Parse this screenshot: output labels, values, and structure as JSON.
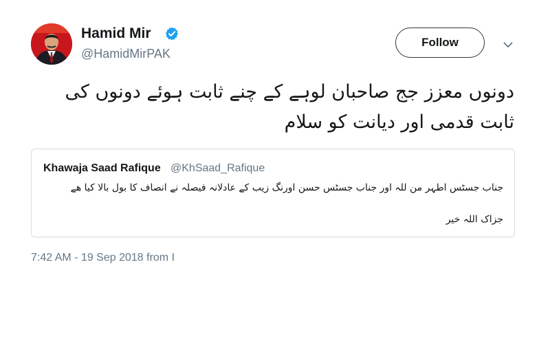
{
  "author": {
    "name": "Hamid Mir",
    "handle": "@HamidMirPAK",
    "verified": true,
    "avatar_icon": "profile-photo"
  },
  "actions": {
    "follow_label": "Follow",
    "menu_icon": "chevron-down-icon"
  },
  "tweet": {
    "text": "دونوں معزز جج صاحبان لوہے کے چنے ثابت ہوئے دونوں کی ثابت قدمی اور دیانت کو سلام"
  },
  "quoted": {
    "name": "Khawaja Saad Rafique",
    "handle": "@KhSaad_Rafique",
    "text_line1": "جناب جسٹس اطہر من للہ اور جناب جسٹس حسن اورنگ زیب کے عادلانہ فیصلہ نے انصاف کا بول بالا کیا ھے",
    "text_line2": "جزاک اللہ خیر"
  },
  "meta": {
    "timestamp": "7:42 AM - 19 Sep 2018 from I"
  },
  "colors": {
    "text": "#14171a",
    "secondary": "#657786",
    "verified_blue": "#1da1f2",
    "border": "#d5dde3"
  }
}
